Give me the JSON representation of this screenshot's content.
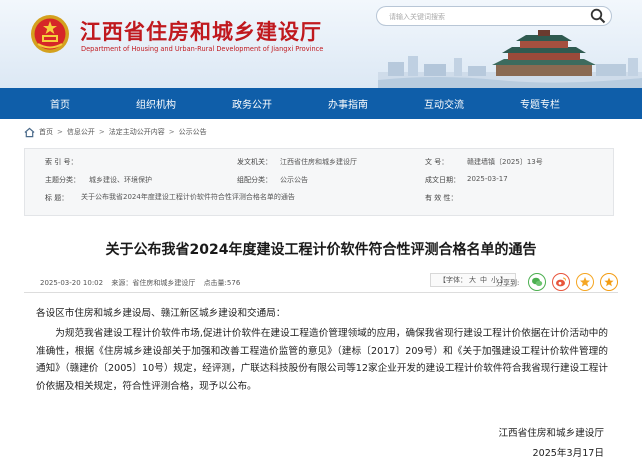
{
  "header": {
    "title": "江西省住房和城乡建设厅",
    "subtitle": "Department of Housing and Urban-Rural Development of Jiangxi Province",
    "search_placeholder": "请输入关键词搜索"
  },
  "nav": {
    "items": [
      "首页",
      "组织机构",
      "政务公开",
      "办事指南",
      "互动交流",
      "专题专栏"
    ]
  },
  "breadcrumb": [
    "首页",
    "信息公开",
    "法定主动公开内容",
    "公示公告"
  ],
  "info": {
    "index_label": "索  引  号：",
    "index_value": "",
    "issuer_label": "发文机关：",
    "issuer_value": "江西省住房和城乡建设厅",
    "doc_no_label": "文        号：",
    "doc_no_value": "赣建墙镇〔2025〕13号",
    "topic_label": "主题分类：",
    "topic_value": "城乡建设、环境保护",
    "category_label": "组配分类：",
    "category_value": "公示公告",
    "date_label": "成文日期：",
    "date_value": "2025-03-17",
    "title_label": "标      题：",
    "title_value": "关于公布我省2024年度建设工程计价软件符合性评测合格名单的通告",
    "validity_label": "有  效  性：",
    "validity_value": ""
  },
  "article": {
    "title": "关于公布我省2024年度建设工程计价软件符合性评测合格名单的通告",
    "datetime": "2025-03-20 10:02",
    "source": "来源：省住房和城乡建设厅",
    "views": "点击量:576",
    "font_size_label": "【字体：",
    "font_sizes": [
      "大",
      "中",
      "小"
    ],
    "font_size_close": "】",
    "share_label": "分享到:",
    "salutation": "各设区市住房和城乡建设局、赣江新区城乡建设和交通局：",
    "paragraph": "为规范我省建设工程计价软件市场,促进计价软件在建设工程造价管理领域的应用，确保我省现行建设工程计价依据在计价活动中的准确性，根据《住房城乡建设部关于加强和改善工程造价监管的意见》（建标〔2017〕209号）和《关于加强建设工程计价软件管理的通知》（赣建价〔2005〕10号）规定，经评测，广联达科技股份有限公司等12家企业开发的建设工程计价软件符合我省现行建设工程计价依据及相关规定，符合性评测合格，现予以公布。",
    "signature": "江西省住房和城乡建设厅",
    "sign_date": "2025年3月17日"
  },
  "share_buttons": [
    {
      "name": "wechat-share-icon",
      "color": "#4caf50"
    },
    {
      "name": "weibo-share-icon",
      "color": "#e8553c"
    },
    {
      "name": "qzone-share-icon",
      "color": "#f5a623"
    },
    {
      "name": "favorite-share-icon",
      "color": "#f39c12"
    }
  ],
  "colors": {
    "title_red": "#c0191e",
    "nav_blue": "#0f5ea9"
  }
}
